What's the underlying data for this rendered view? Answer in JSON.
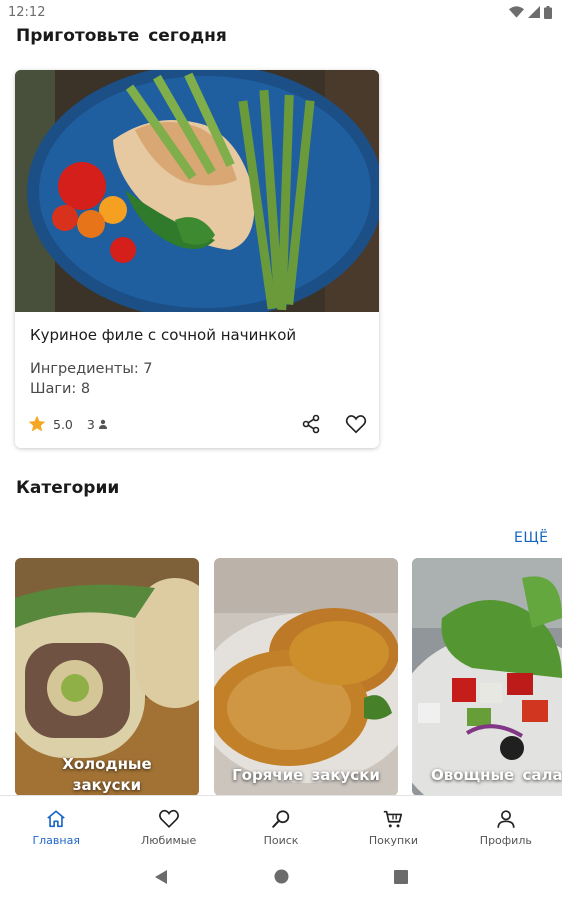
{
  "status_bar": {
    "time": "12:12"
  },
  "today": {
    "title": "Приготовьте сегодня",
    "recipe": {
      "name": "Куриное филе с сочной начинкой",
      "ingredients": "Ингредиенты: 7",
      "steps": "Шаги: 8",
      "rating": "5.0",
      "votes": "3"
    }
  },
  "categories": {
    "title": "Категории",
    "more_label": "ЕЩЁ",
    "items": [
      {
        "line1": "Холодные",
        "line2": "закуски"
      },
      {
        "label": "Горячие закуски"
      },
      {
        "label": "Овощные салаты"
      }
    ]
  },
  "bottom_nav": {
    "items": [
      {
        "label": "Главная",
        "icon": "home-icon",
        "active": true
      },
      {
        "label": "Любимые",
        "icon": "heart-icon"
      },
      {
        "label": "Поиск",
        "icon": "search-icon"
      },
      {
        "label": "Покупки",
        "icon": "cart-icon"
      },
      {
        "label": "Профиль",
        "icon": "person-icon"
      }
    ]
  },
  "colors": {
    "accent": "#1e66c8",
    "link": "#1565c0",
    "star": "#f5a623"
  }
}
